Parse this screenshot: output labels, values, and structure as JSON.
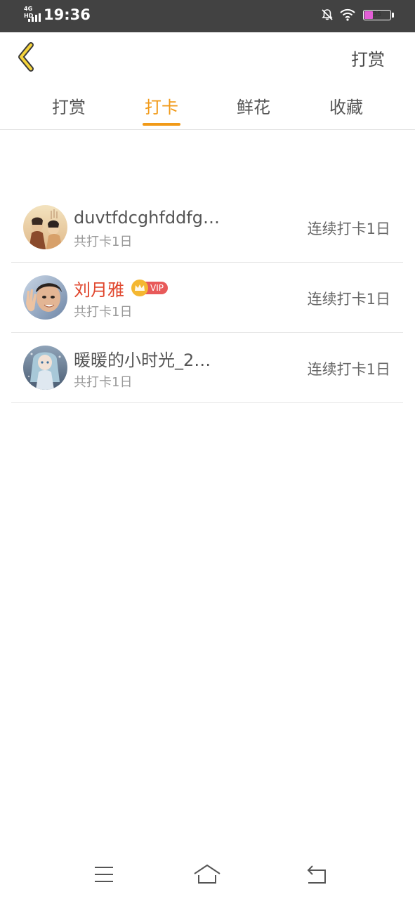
{
  "status_bar": {
    "network_label": "4G HD",
    "time": "19:36",
    "battery_level": 35,
    "battery_text": "35",
    "icons": [
      "signal-icon",
      "mute-bell-icon",
      "wifi-icon",
      "battery-icon"
    ]
  },
  "header": {
    "back_icon": "chevron-left-icon",
    "action_label": "打赏"
  },
  "tabs": [
    {
      "label": "打赏",
      "active": false
    },
    {
      "label": "打卡",
      "active": true
    },
    {
      "label": "鲜花",
      "active": false
    },
    {
      "label": "收藏",
      "active": false
    }
  ],
  "colors": {
    "accent": "#f19a18",
    "vip_name": "#e0472e",
    "vip_badge": "#e85a5a",
    "status_bar_bg": "#424242"
  },
  "checkins": [
    {
      "name": "duvtfdcghfddfg…",
      "vip": false,
      "total": "共打卡1日",
      "streak": "连续打卡1日"
    },
    {
      "name": "刘月雅",
      "vip": true,
      "vip_label": "VIP",
      "total": "共打卡1日",
      "streak": "连续打卡1日"
    },
    {
      "name": "暖暖的小时光_2…",
      "vip": false,
      "total": "共打卡1日",
      "streak": "连续打卡1日"
    }
  ],
  "bottom_nav": [
    "menu-icon",
    "home-icon",
    "back-icon"
  ]
}
